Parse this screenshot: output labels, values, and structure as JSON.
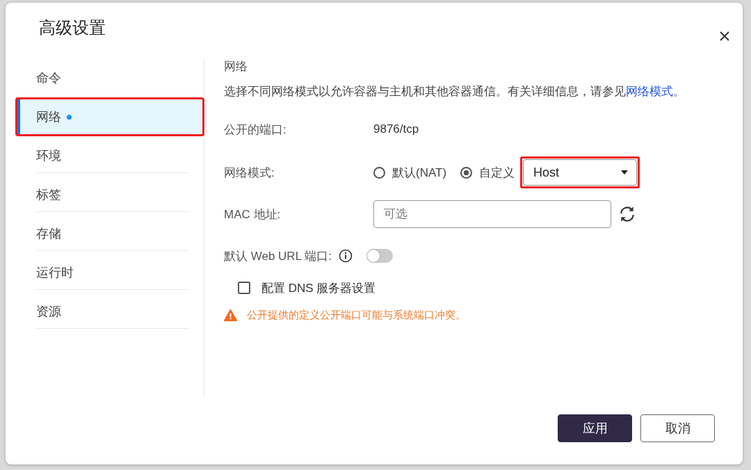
{
  "dialog": {
    "title": "高级设置"
  },
  "sidebar": {
    "items": [
      {
        "label": "命令",
        "selected": false,
        "modified": false,
        "highlighted": false
      },
      {
        "label": "网络",
        "selected": true,
        "modified": true,
        "highlighted": true
      },
      {
        "label": "环境",
        "selected": false,
        "modified": false,
        "highlighted": false
      },
      {
        "label": "标签",
        "selected": false,
        "modified": false,
        "highlighted": false
      },
      {
        "label": "存储",
        "selected": false,
        "modified": false,
        "highlighted": false
      },
      {
        "label": "运行时",
        "selected": false,
        "modified": false,
        "highlighted": false
      },
      {
        "label": "资源",
        "selected": false,
        "modified": false,
        "highlighted": false
      }
    ]
  },
  "content": {
    "heading": "网络",
    "description": {
      "text": "选择不同网络模式以允许容器与主机和其他容器通信。有关详细信息，请参见",
      "link": "网络模式",
      "end": "。"
    },
    "fields": [
      {
        "kind": "text",
        "label": "公开的端口:",
        "value": "9876/tcp"
      },
      {
        "kind": "radio",
        "label": "网络模式:",
        "options": [
          {
            "label": "默认(NAT)",
            "selected": false
          },
          {
            "label": "自定义",
            "selected": true
          }
        ],
        "select": {
          "value": "Host",
          "highlighted": true
        }
      },
      {
        "kind": "input",
        "label": "MAC 地址:",
        "placeholder": "可选"
      },
      {
        "kind": "toggle",
        "label": "默认 Web URL 端口:",
        "on": false
      },
      {
        "kind": "checkbox",
        "label": "配置 DNS 服务器设置",
        "checked": false
      }
    ],
    "warning": "公开提供的定义公开端口可能与系统端口冲突。"
  },
  "buttons": [
    {
      "label": "应用",
      "kind": "primary"
    },
    {
      "label": "取消",
      "kind": "secondary"
    }
  ]
}
